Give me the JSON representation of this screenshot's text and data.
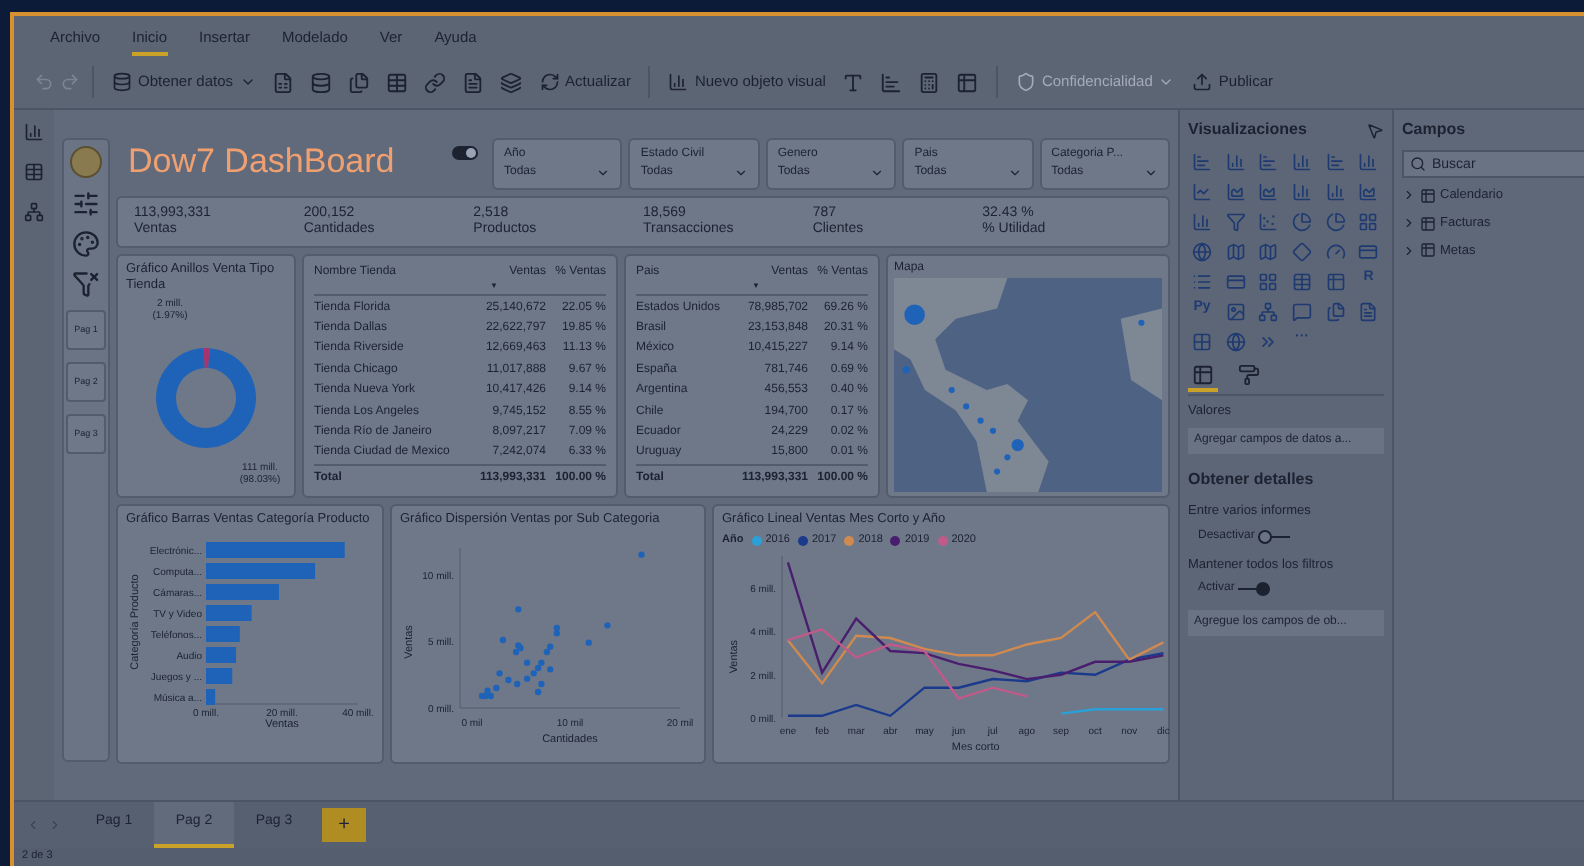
{
  "menu": [
    {
      "label": "Archivo",
      "selected": false
    },
    {
      "label": "Inicio",
      "selected": true
    },
    {
      "label": "Insertar",
      "selected": false
    },
    {
      "label": "Modelado",
      "selected": false
    },
    {
      "label": "Ver",
      "selected": false
    },
    {
      "label": "Ayuda",
      "selected": false
    }
  ],
  "toolbar": {
    "get_data": {
      "label": "Obtener datos"
    },
    "refresh": {
      "label": "Actualizar"
    },
    "new_visual": {
      "label": "Nuevo objeto visual"
    },
    "sensitivity": {
      "label": "Confidencialidad",
      "disabled": true
    },
    "publish": {
      "label": "Publicar"
    }
  },
  "canvas": {
    "title": "Dow7 DashBoard",
    "theme_toggle": {
      "on": true
    },
    "nav_pages": [
      {
        "label": "Pag 1"
      },
      {
        "label": "Pag 2"
      },
      {
        "label": "Pag 3"
      }
    ],
    "slicers": [
      {
        "label": "Año",
        "value": "Todas"
      },
      {
        "label": "Estado Civil",
        "value": "Todas"
      },
      {
        "label": "Genero",
        "value": "Todas"
      },
      {
        "label": "Pais",
        "value": "Todas"
      },
      {
        "label": "Categoria P...",
        "value": "Todas"
      }
    ],
    "kpis": [
      {
        "value": "113,993,331",
        "label": "Ventas"
      },
      {
        "value": "200,152",
        "label": "Cantidades"
      },
      {
        "value": "2,518",
        "label": "Productos"
      },
      {
        "value": "18,569",
        "label": "Transacciones"
      },
      {
        "value": "787",
        "label": "Clientes"
      },
      {
        "value": "32.43 %",
        "label": "% Utilidad"
      }
    ],
    "donut": {
      "title": "Gráfico Anillos Venta Tipo Tienda",
      "chart_data": {
        "type": "donut",
        "values": [
          1.97,
          98.03
        ],
        "value_labels": [
          "2 mill. (1.97%)",
          "111 mill. (98.03%)"
        ]
      }
    },
    "store_table": {
      "columns": [
        "Nombre Tienda",
        "Ventas",
        "% Ventas"
      ],
      "sort_indicator": "▼",
      "rows": [
        [
          "Tienda Florida",
          "25,140,672",
          "22.05 %"
        ],
        [
          "Tienda Dallas",
          "22,622,797",
          "19.85 %"
        ],
        [
          "Tienda Riverside",
          "12,669,463",
          "11.13 %"
        ],
        [
          "Tienda Chicago",
          "11,017,888",
          "9.67 %"
        ],
        [
          "Tienda Nueva York",
          "10,417,426",
          "9.14 %"
        ],
        [
          "Tienda Los Angeles",
          "9,745,152",
          "8.55 %"
        ],
        [
          "Tienda Río de Janeiro",
          "8,097,217",
          "7.09 %"
        ],
        [
          "Tienda Ciudad de Mexico",
          "7,242,074",
          "6.33 %"
        ]
      ],
      "total": [
        "Total",
        "113,993,331",
        "100.00 %"
      ]
    },
    "country_table": {
      "columns": [
        "Pais",
        "Ventas",
        "% Ventas"
      ],
      "sort_indicator": "▼",
      "rows": [
        [
          "Estados Unidos",
          "78,985,702",
          "69.26 %"
        ],
        [
          "Brasil",
          "23,153,848",
          "20.31 %"
        ],
        [
          "México",
          "10,415,227",
          "9.14 %"
        ],
        [
          "España",
          "781,746",
          "0.69 %"
        ],
        [
          "Argentina",
          "456,553",
          "0.40 %"
        ],
        [
          "Chile",
          "194,700",
          "0.17 %"
        ],
        [
          "Ecuador",
          "24,229",
          "0.02 %"
        ],
        [
          "Uruguay",
          "15,800",
          "0.01 %"
        ]
      ],
      "total": [
        "Total",
        "113,993,331",
        "100.00 %"
      ]
    },
    "map": {
      "title": "Mapa"
    },
    "bar": {
      "title": "Gráfico Barras Ventas Categoría Producto",
      "chart_data": {
        "type": "bar",
        "orientation": "horizontal",
        "xlabel": "Ventas",
        "ylabel": "Categoría Producto",
        "categories": [
          "Electrónic...",
          "Computa...",
          "Cámaras...",
          "TV y Video",
          "Teléfonos...",
          "Audio",
          "Juegos y ...",
          "Música a..."
        ],
        "values": [
          36.5,
          28.7,
          19.2,
          12,
          8.9,
          7.9,
          6.9,
          2.4
        ],
        "xlim": [
          0,
          40
        ],
        "xticks": [
          {
            "value": 0,
            "label": "0 mill."
          },
          {
            "value": 20,
            "label": "20 mill."
          },
          {
            "value": 40,
            "label": "40 mill."
          }
        ]
      }
    },
    "scatter": {
      "title": "Gráfico Dispersión Ventas por Sub Categoria",
      "chart_data": {
        "type": "scatter",
        "xlabel": "Cantidades",
        "ylabel": "Ventas",
        "x": [
          16.5,
          5.3,
          13.4,
          8.8,
          8.8,
          3.9,
          11.7,
          5.3,
          5.5,
          5.1,
          8.2,
          7.9,
          6.1,
          7.4,
          7.1,
          8.2,
          3.6,
          6.7,
          6.1,
          4.4,
          5.2,
          7.4,
          3.3,
          2.5,
          2.3,
          2.8,
          2.0,
          7.1
        ],
        "values": [
          11.5,
          7.4,
          6.2,
          6.0,
          5.6,
          5.1,
          4.9,
          4.7,
          4.5,
          4.2,
          4.6,
          4.2,
          3.4,
          3.4,
          3.0,
          2.9,
          2.6,
          2.6,
          2.2,
          2.1,
          1.8,
          1.8,
          1.5,
          1.3,
          0.9,
          0.9,
          0.9,
          1.2
        ],
        "xlim": [
          0,
          20
        ],
        "ylim": [
          0,
          12
        ],
        "xticks": [
          {
            "value": 0,
            "label": "0 mil"
          },
          {
            "value": 10,
            "label": "10 mil"
          },
          {
            "value": 20,
            "label": "20 mil"
          }
        ],
        "yticks": [
          {
            "value": 0,
            "label": "0 mill."
          },
          {
            "value": 5,
            "label": "5 mill."
          },
          {
            "value": 10,
            "label": "10 mill."
          }
        ]
      }
    },
    "line": {
      "title": "Gráfico Lineal Ventas Mes Corto y Año",
      "legend_title": "Año",
      "chart_data": {
        "type": "line",
        "xlabel": "Mes corto",
        "ylabel": "Ventas",
        "categories": [
          "ene",
          "feb",
          "mar",
          "abr",
          "may",
          "jun",
          "jul",
          "ago",
          "sep",
          "oct",
          "nov",
          "dic"
        ],
        "series": [
          {
            "name": "2016",
            "color": "#2aa0d8",
            "values": [
              null,
              null,
              null,
              null,
              null,
              null,
              null,
              null,
              0.2,
              0.4,
              0.4,
              0.4
            ]
          },
          {
            "name": "2017",
            "color": "#1b3a8c",
            "values": [
              0.1,
              0.1,
              0.6,
              0.1,
              1.4,
              1.4,
              1.8,
              1.7,
              2.1,
              2.0,
              2.7,
              3.0
            ]
          },
          {
            "name": "2018",
            "color": "#d08a50",
            "values": [
              3.6,
              1.6,
              3.8,
              3.7,
              3.2,
              2.9,
              2.9,
              3.4,
              3.7,
              4.9,
              2.7,
              3.5
            ]
          },
          {
            "name": "2019",
            "color": "#4a1e6e",
            "values": [
              7.2,
              2.1,
              4.6,
              3.1,
              3.0,
              2.5,
              2.2,
              1.8,
              2.0,
              2.6,
              2.6,
              2.9
            ]
          },
          {
            "name": "2020",
            "color": "#c05a8a",
            "values": [
              3.6,
              4.1,
              2.8,
              3.4,
              3.1,
              0.9,
              1.4,
              1.0,
              null,
              null,
              null,
              null
            ]
          }
        ],
        "ylim": [
          0,
          7.5
        ],
        "yticks": [
          {
            "value": 0,
            "label": "0 mill."
          },
          {
            "value": 2,
            "label": "2 mill."
          },
          {
            "value": 4,
            "label": "4 mill."
          },
          {
            "value": 6,
            "label": "6 mill."
          }
        ]
      }
    }
  },
  "visualizations": {
    "title": "Visualizaciones",
    "glyphs": [
      "R",
      "Py",
      "···"
    ],
    "tabs": [
      {
        "kind": "fields",
        "selected": true
      },
      {
        "kind": "format",
        "selected": false
      }
    ],
    "section": "Valores",
    "drop_field": "Agregar campos de datos a...",
    "drill_title": "Obtener detalles",
    "cross_report": {
      "label": "Entre varios informes",
      "state_label": "Desactivar",
      "on": false
    },
    "keep_filters": {
      "label": "Mantener todos los filtros",
      "state_label": "Activar",
      "on": true
    },
    "drill_field": "Agregue los campos de ob..."
  },
  "fields": {
    "title": "Campos",
    "search_placeholder": "Buscar",
    "tables": [
      {
        "name": "Calendario",
        "expanded": false
      },
      {
        "name": "Facturas",
        "expanded": false
      },
      {
        "name": "Metas",
        "expanded": false
      }
    ]
  },
  "page_tabs": [
    {
      "label": "Pag 1",
      "selected": false
    },
    {
      "label": "Pag 2",
      "selected": true
    },
    {
      "label": "Pag 3",
      "selected": false
    }
  ],
  "add_page": "+",
  "status": "2 de 3"
}
